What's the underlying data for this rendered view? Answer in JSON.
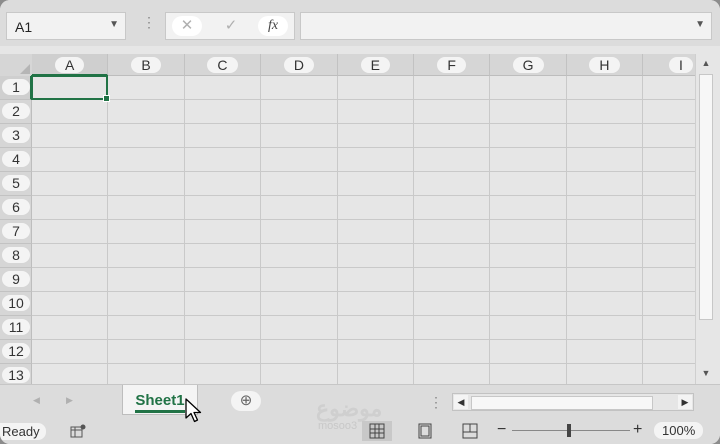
{
  "formula_bar": {
    "name_box": "A1",
    "cancel_icon": "✕",
    "enter_icon": "✓",
    "function_label": "fx",
    "formula_value": ""
  },
  "grid": {
    "columns": [
      "A",
      "B",
      "C",
      "D",
      "E",
      "F",
      "G",
      "H",
      "I"
    ],
    "rows": [
      "1",
      "2",
      "3",
      "4",
      "5",
      "6",
      "7",
      "8",
      "9",
      "10",
      "11",
      "12",
      "13"
    ],
    "active_cell": "A1"
  },
  "tabs": {
    "sheets": [
      "Sheet1"
    ],
    "add_sheet_icon": "⊕"
  },
  "status_bar": {
    "status": "Ready",
    "zoom": "100%",
    "zoom_minus": "−",
    "zoom_plus": "+",
    "watermark": "موضوع",
    "watermark_sub": "mosoo3"
  },
  "colors": {
    "accent": "#217346",
    "grid_line": "#c9c9c9",
    "header_bg": "#d6d6d6"
  }
}
